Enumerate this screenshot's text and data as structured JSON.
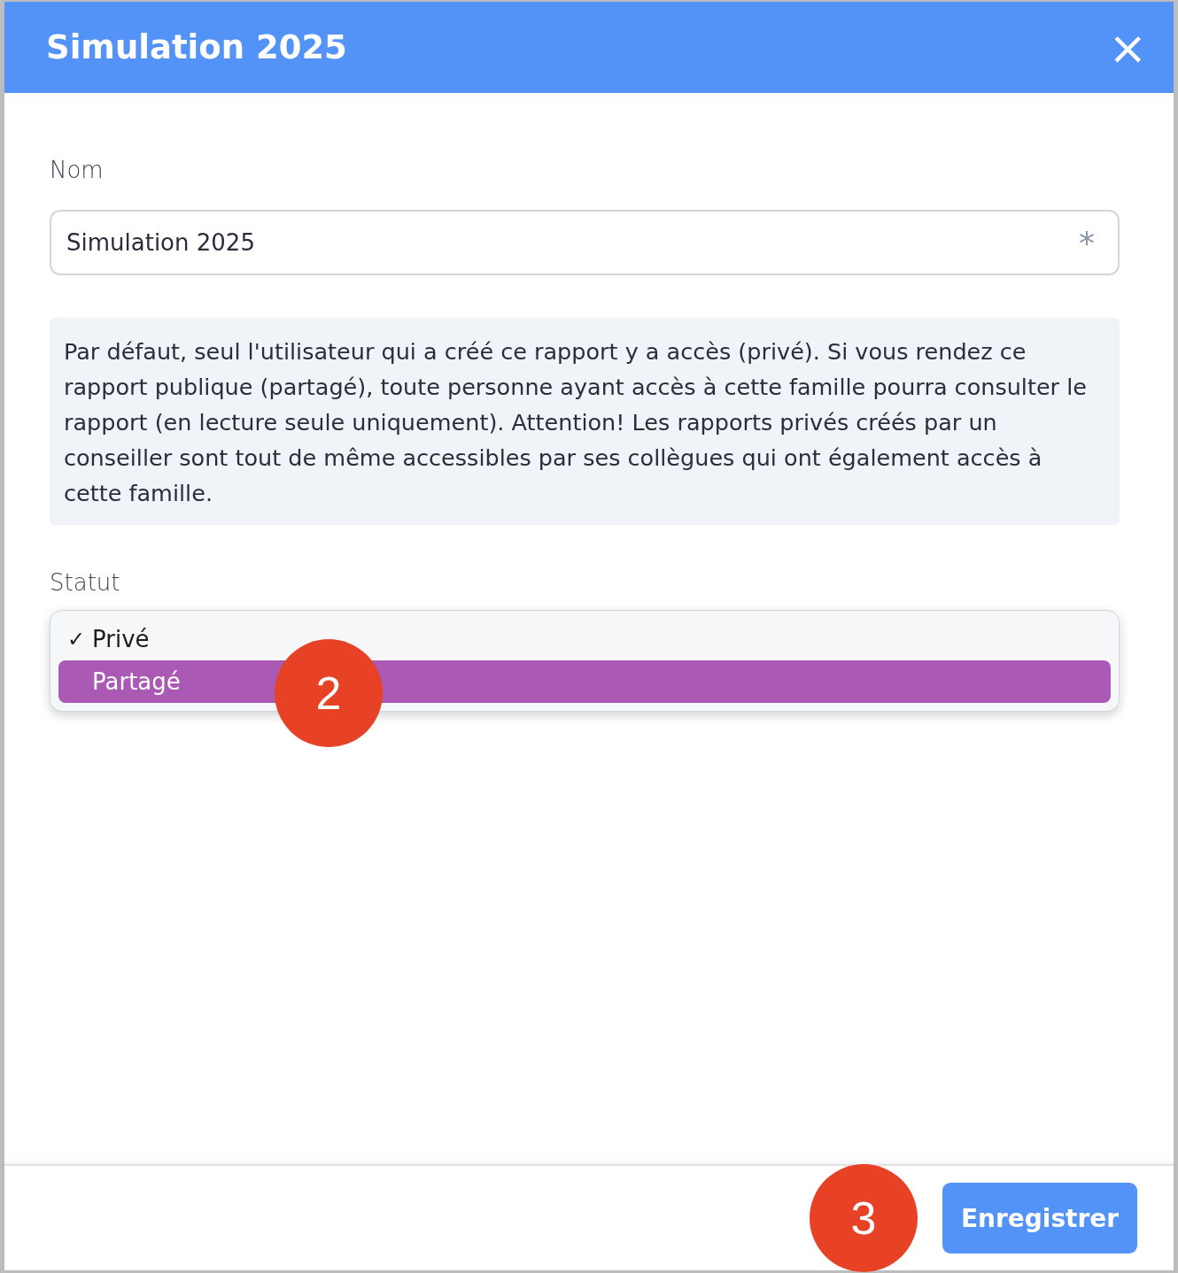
{
  "dialog": {
    "title": "Simulation 2025",
    "close_label": "×"
  },
  "name_field": {
    "label": "Nom",
    "value": "Simulation 2025",
    "required_mark": "*"
  },
  "info_text": "Par défaut, seul l'utilisateur qui a créé ce rapport y a accès (privé). Si vous rendez ce rapport publique (partagé), toute personne ayant accès à cette famille pourra consulter le rapport (en lecture seule uniquement). Attention! Les rapports privés créés par un conseiller sont tout de même accessibles par ses collègues qui ont également accès à cette famille.",
  "status_field": {
    "label": "Statut",
    "check_mark": "✓",
    "options": [
      {
        "label": "Privé",
        "selected": true,
        "highlighted": false
      },
      {
        "label": "Partagé",
        "selected": false,
        "highlighted": true,
        "step_badge": "2"
      }
    ]
  },
  "footer": {
    "save_button": {
      "label": "Enregistrer",
      "step_badge": "3"
    }
  }
}
